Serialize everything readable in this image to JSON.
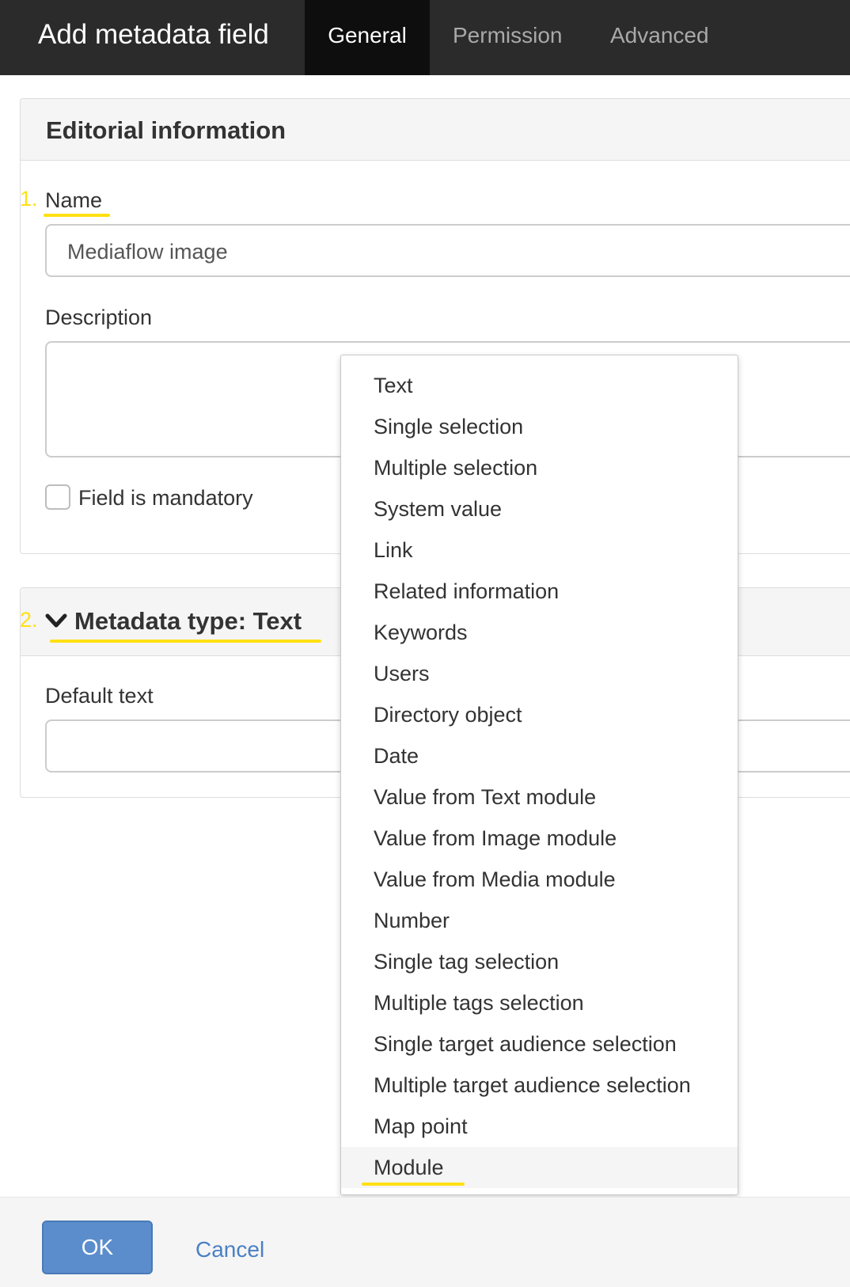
{
  "header": {
    "title": "Add metadata field",
    "tabs": [
      {
        "label": "General",
        "active": true
      },
      {
        "label": "Permission",
        "active": false
      },
      {
        "label": "Advanced",
        "active": false
      }
    ]
  },
  "editorial": {
    "heading": "Editorial information",
    "name_label": "Name",
    "name_value": "Mediaflow image",
    "description_label": "Description",
    "description_value": "",
    "mandatory_label": "Field is mandatory",
    "mandatory_checked": false
  },
  "metadata_type": {
    "heading": "Metadata type: Text",
    "default_text_label": "Default text",
    "default_text_value": ""
  },
  "annotations": {
    "marker_1": "1.",
    "marker_2": "2.",
    "highlight_color": "#ffe014"
  },
  "dropdown": {
    "items": [
      "Text",
      "Single selection",
      "Multiple selection",
      "System value",
      "Link",
      "Related information",
      "Keywords",
      "Users",
      "Directory object",
      "Date",
      "Value from Text module",
      "Value from Image module",
      "Value from Media module",
      "Number",
      "Single tag selection",
      "Multiple tags selection",
      "Single target audience selection",
      "Multiple target audience selection",
      "Map point",
      "Module"
    ],
    "hovered_item": "Module"
  },
  "footer": {
    "ok_label": "OK",
    "cancel_label": "Cancel"
  },
  "colors": {
    "topbar": "#2b2b2b",
    "active_tab": "#0e0e0e",
    "primary_button": "#5b8dcc",
    "link": "#4a80c4"
  }
}
